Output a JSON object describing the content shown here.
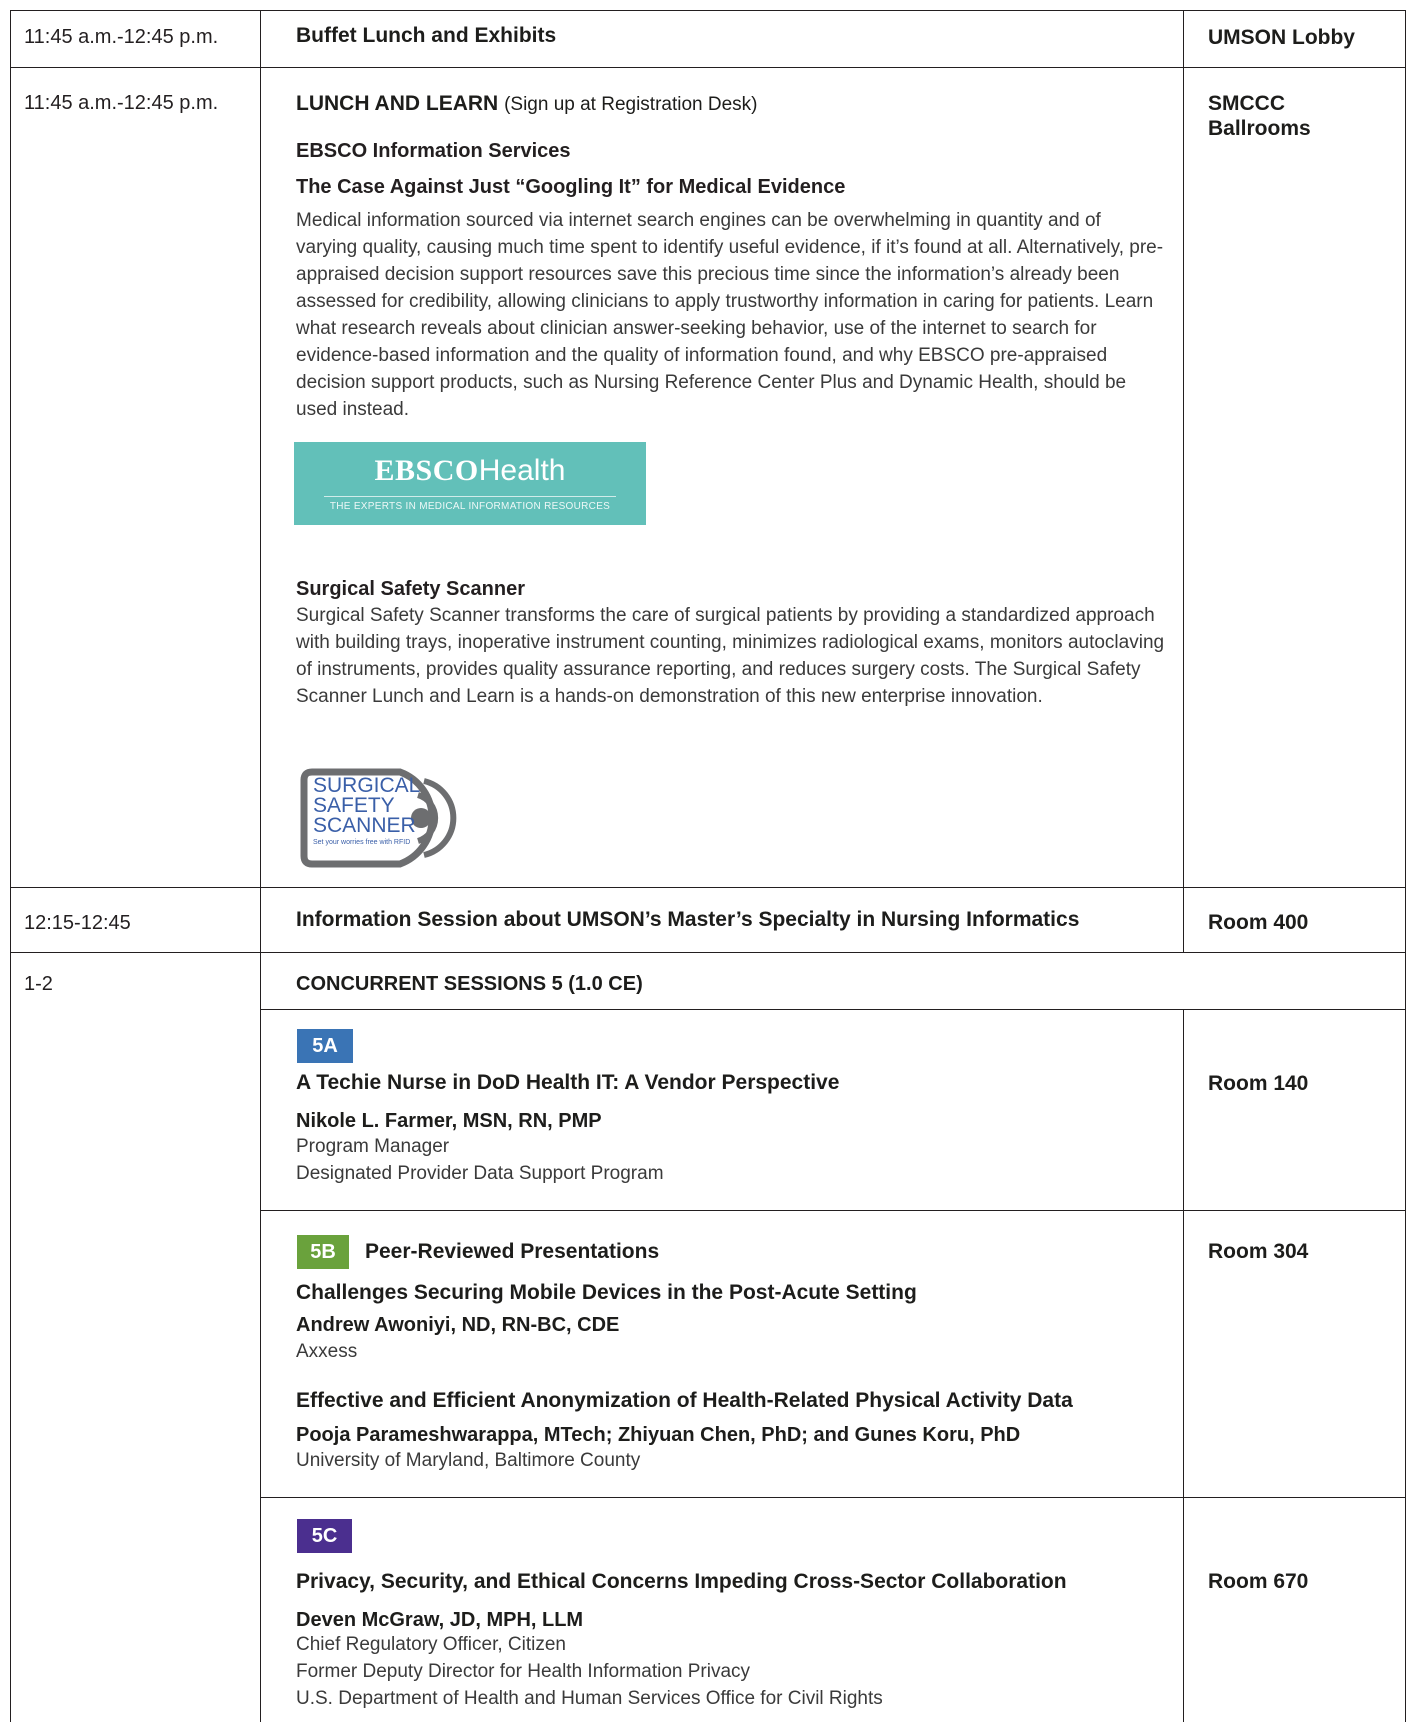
{
  "rows": [
    {
      "time": "11:45 a.m.-12:45 p.m.",
      "title": "Buffet Lunch and Exhibits",
      "room": "UMSON Lobby"
    },
    {
      "time": "11:45 a.m.-12:45 p.m.",
      "title_bold": "LUNCH AND LEARN",
      "title_rest": "(Sign up at Registration Desk)",
      "room_line1": "SMCCC",
      "room_line2": "Ballrooms",
      "ebsco": {
        "company": "EBSCO Information Services",
        "talk_title": "The Case Against Just “Googling It” for Medical Evidence",
        "description": "Medical information sourced via internet search engines can be overwhelming in quantity and of varying quality, causing much time spent to identify useful evidence, if it’s found at all. Alternatively, pre-appraised decision support resources save this precious time since the information’s already been assessed for credibility, allowing clinicians to apply trustworthy information in caring for patients. Learn what research reveals about clinician answer-seeking behavior, use of the internet to search for evidence-based information and the quality of information found, and why EBSCO pre-appraised decision support products, such as Nursing Reference Center Plus and Dynamic Health, should be used instead.",
        "logo_strong": "EBSCO",
        "logo_light": "Health",
        "logo_tagline": "THE EXPERTS IN MEDICAL INFORMATION RESOURCES",
        "logo_color": "#62c0b9"
      },
      "sss": {
        "company": "Surgical Safety Scanner",
        "description": "Surgical Safety Scanner transforms the care of surgical patients by providing a standardized approach with building trays, inoperative instrument counting, minimizes radiological exams, monitors autoclaving of instruments, provides quality assurance reporting, and reduces surgery costs. The Surgical Safety Scanner Lunch and Learn is a hands-on demonstration of this new enterprise innovation.",
        "logo_line1": "SURGICAL",
        "logo_line2": "SAFETY",
        "logo_line3": "SCANNER",
        "logo_tagline": "Set your worries free with RFID",
        "logo_text_color": "#3a5fa8",
        "logo_frame_color": "#6d6e70"
      }
    },
    {
      "time": "12:15-12:45",
      "title": "Information Session about UMSON’s Master’s Specialty in Nursing Informatics",
      "room": "Room 400"
    },
    {
      "time": "1-2",
      "title": "CONCURRENT SESSIONS 5  (1.0 CE)",
      "sessions": [
        {
          "badge": "5A",
          "badge_color": "#3a74b5",
          "title": "A Techie Nurse in DoD Health IT: A Vendor Perspective",
          "speaker": "Nikole L. Farmer, MSN, RN, PMP",
          "affil1": "Program Manager",
          "affil2": "Designated Provider Data Support Program",
          "room": "Room 140"
        },
        {
          "badge": "5B",
          "badge_color": "#6aa23c",
          "badge_label": "Peer-Reviewed Presentations",
          "room": "Room 304",
          "talks": [
            {
              "title": "Challenges Securing Mobile Devices in the Post-Acute Setting",
              "speaker": "Andrew Awoniyi, ND, RN-BC, CDE",
              "affil": "Axxess"
            },
            {
              "title": "Effective and Efficient Anonymization of Health-Related Physical Activity Data",
              "speaker": "Pooja Parameshwarappa, MTech; Zhiyuan Chen, PhD; and Gunes Koru, PhD",
              "affil": "University of Maryland, Baltimore County"
            }
          ]
        },
        {
          "badge": "5C",
          "badge_color": "#4b2f8f",
          "title": "Privacy, Security, and Ethical Concerns Impeding Cross-Sector Collaboration",
          "speaker": "Deven McGraw, JD, MPH, LLM",
          "affil1": "Chief Regulatory Officer, Citizen",
          "affil2": "Former Deputy Director for Health Information Privacy",
          "affil3": "U.S. Department of Health and Human Services Office for Civil Rights",
          "room": "Room 670"
        }
      ]
    }
  ]
}
